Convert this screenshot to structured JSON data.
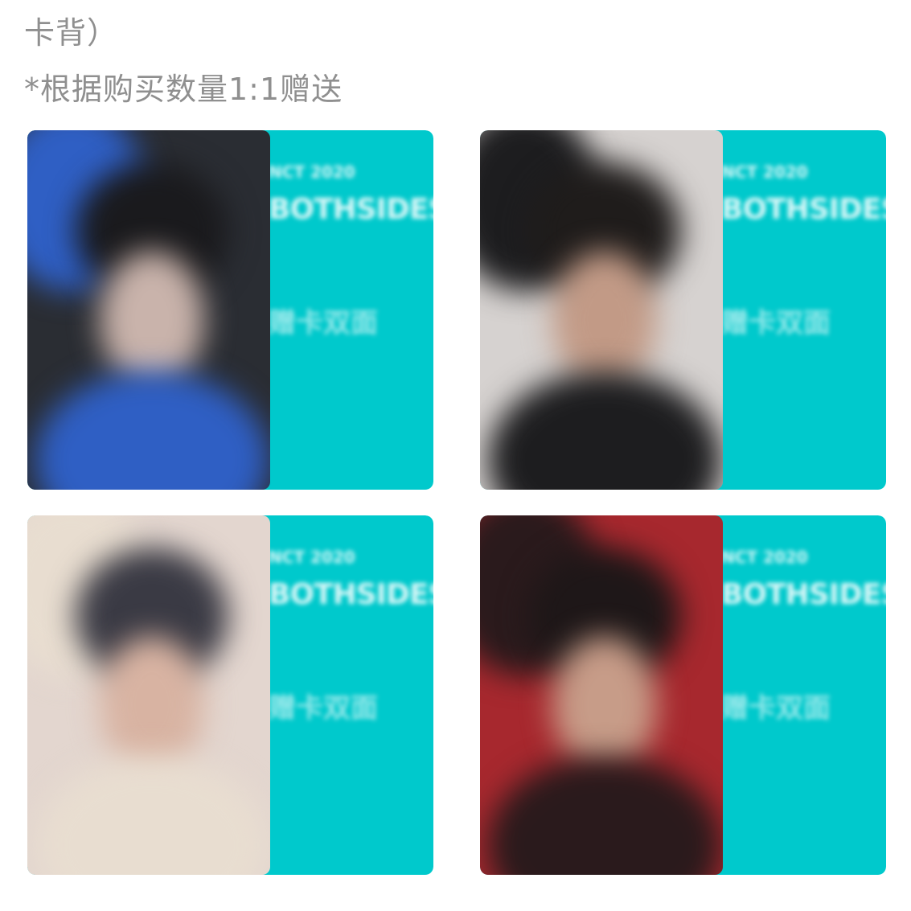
{
  "header": {
    "line1": "卡背）",
    "line2": "*根据购买数量1:1赠送"
  },
  "cards": [
    {
      "back_small": "NCT 2020",
      "back_big": "BOTHSIDES",
      "back_cn": "赠卡双面",
      "photo_colors": {
        "bg": "#2a2d33",
        "accent": "#2f5fc4",
        "skin": "#c9b3ab",
        "hair": "#1a1a1d"
      }
    },
    {
      "back_small": "NCT 2020",
      "back_big": "BOTHSIDES",
      "back_cn": "赠卡双面",
      "photo_colors": {
        "bg": "#d6d2d0",
        "accent": "#1d1d1f",
        "skin": "#c29a86",
        "hair": "#1f1c1b"
      }
    },
    {
      "back_small": "NCT 2020",
      "back_big": "BOTHSIDES",
      "back_cn": "赠卡双面",
      "photo_colors": {
        "bg": "#e3d6cf",
        "accent": "#e8ddd0",
        "skin": "#d8b3a2",
        "hair": "#3a3a44"
      }
    },
    {
      "back_small": "NCT 2020",
      "back_big": "BOTHSIDES",
      "back_cn": "赠卡双面",
      "photo_colors": {
        "bg": "#a7282e",
        "accent": "#2a1a1c",
        "skin": "#c79c88",
        "hair": "#1e1718"
      }
    }
  ]
}
